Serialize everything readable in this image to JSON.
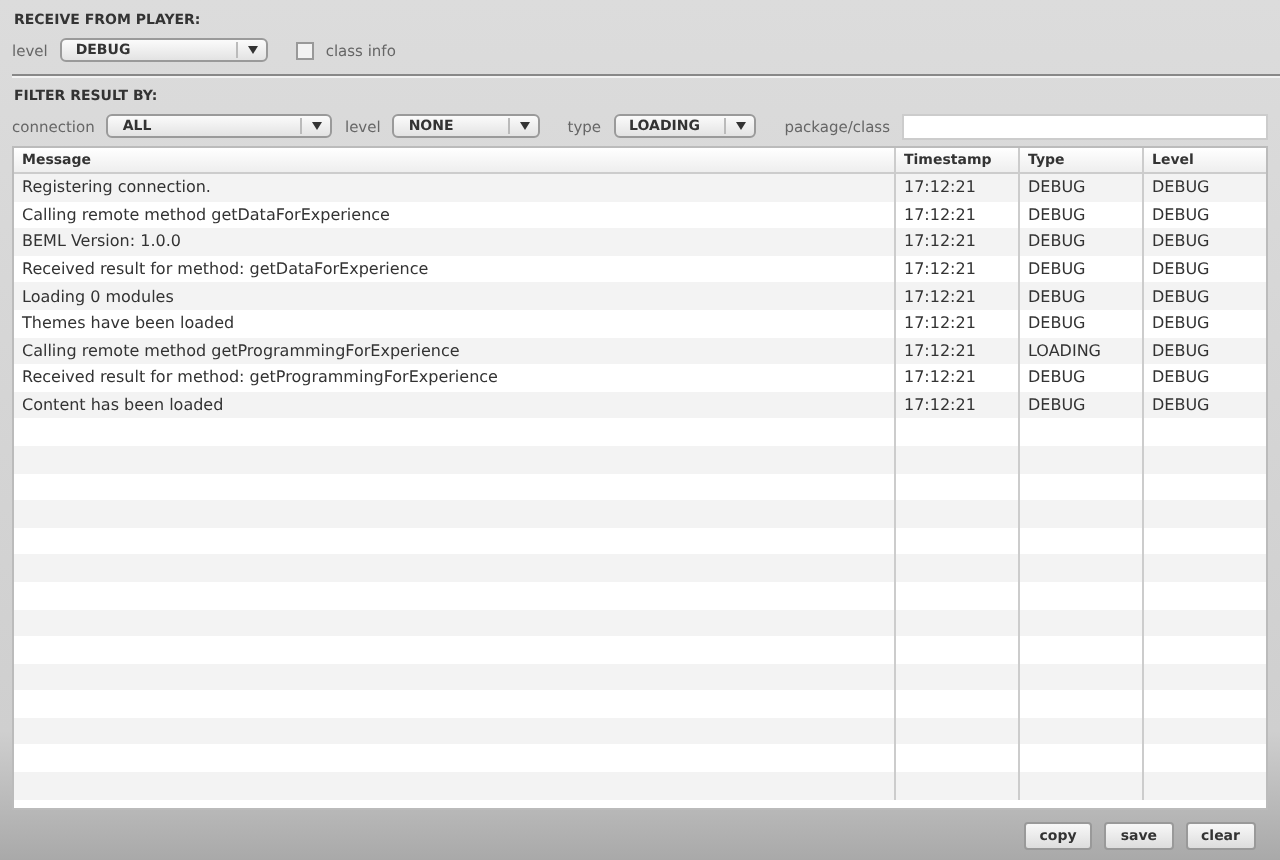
{
  "receive": {
    "title": "RECEIVE FROM PLAYER:",
    "level_label": "level",
    "level_value": "DEBUG",
    "class_info": {
      "label": "class info",
      "checked": false
    }
  },
  "filter": {
    "title": "FILTER RESULT BY:",
    "connection_label": "connection",
    "connection_value": "ALL",
    "level_label": "level",
    "level_value": "NONE",
    "type_label": "type",
    "type_value": "LOADING",
    "package_label": "package/class"
  },
  "table": {
    "columns": [
      "Message",
      "Timestamp",
      "Type",
      "Level"
    ],
    "rows": [
      [
        "Registering connection.",
        "17:12:21",
        "DEBUG",
        "DEBUG"
      ],
      [
        "Calling remote method getDataForExperience",
        "17:12:21",
        "DEBUG",
        "DEBUG"
      ],
      [
        "BEML Version: 1.0.0",
        "17:12:21",
        "DEBUG",
        "DEBUG"
      ],
      [
        "Received result for method: getDataForExperience",
        "17:12:21",
        "DEBUG",
        "DEBUG"
      ],
      [
        "Loading 0 modules",
        "17:12:21",
        "DEBUG",
        "DEBUG"
      ],
      [
        "Themes have been loaded",
        "17:12:21",
        "DEBUG",
        "DEBUG"
      ],
      [
        "Calling remote method getProgrammingForExperience",
        "17:12:21",
        "LOADING",
        "DEBUG"
      ],
      [
        "Received result for method: getProgrammingForExperience",
        "17:12:21",
        "DEBUG",
        "DEBUG"
      ],
      [
        "Content has been loaded",
        "17:12:21",
        "DEBUG",
        "DEBUG"
      ]
    ]
  },
  "buttons": [
    "copy",
    "save",
    "clear"
  ]
}
